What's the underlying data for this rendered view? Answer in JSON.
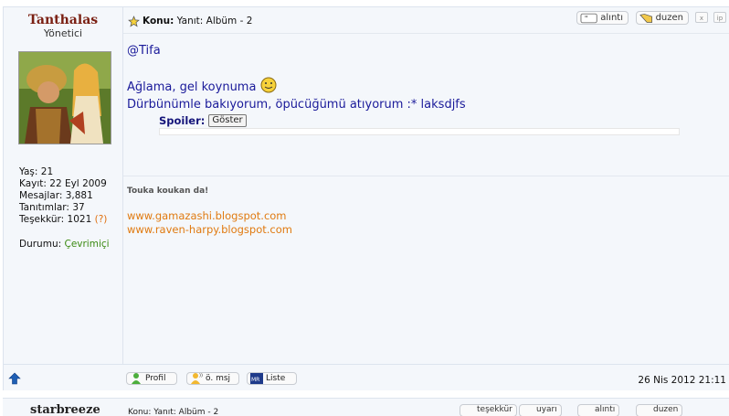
{
  "user": {
    "name": "Tanthalas",
    "rank": "Yönetici",
    "stats": [
      {
        "label": "Yaş:",
        "value": "21"
      },
      {
        "label": "Kayıt:",
        "value": "22 Eyl 2009"
      },
      {
        "label": "Mesajlar:",
        "value": "3,881"
      },
      {
        "label": "Tanıtımlar:",
        "value": "37"
      },
      {
        "label": "Teşekkür:",
        "value": "1021"
      }
    ],
    "thanks_help": "(?)",
    "status_label": "Durumu:",
    "status_value": "Çevrimiçi"
  },
  "post": {
    "subject_label": "Konu:",
    "subject": "Yanıt: Albüm - 2",
    "buttons": {
      "quote": "alıntı",
      "edit": "duzen",
      "x": "x",
      "ip": "ip"
    },
    "lines": [
      "@Tifa",
      "Ağlama, gel koynuma",
      "Dürbünümle bakıyorum, öpücüğümü atıyorum :* laksdjfs"
    ],
    "spoiler_label": "Spoiler:",
    "spoiler_button": "Göster",
    "signature_title": "Touka koukan da!",
    "links": [
      "www.gamazashi.blogspot.com",
      "www.raven-harpy.blogspot.com"
    ]
  },
  "footer": {
    "profile": "Profil",
    "pm": "ö. msj",
    "list": "Liste",
    "date": "26 Nis 2012 21:11"
  },
  "next_post": {
    "user": "starbreeze",
    "subject": "Konu: Yanıt: Albüm - 2",
    "buttons": [
      "teşekkür",
      "uyarı",
      "alıntı",
      "duzen"
    ]
  }
}
